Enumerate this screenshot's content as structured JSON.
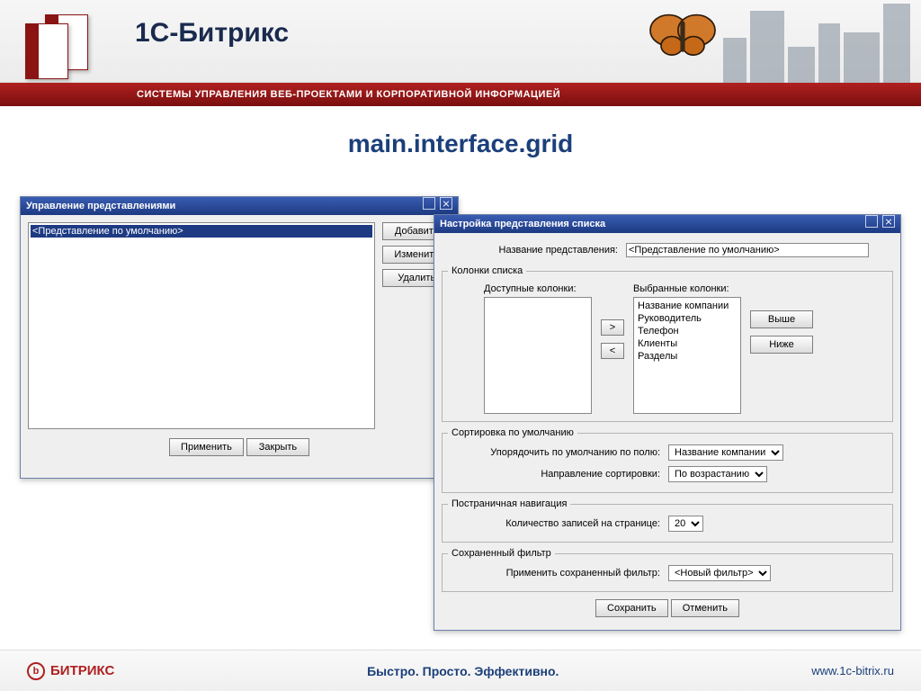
{
  "header": {
    "brand": "1С-Битрикс",
    "tagline": "СИСТЕМЫ УПРАВЛЕНИЯ ВЕБ-ПРОЕКТАМИ И КОРПОРАТИВНОЙ ИНФОРМАЦИЕЙ"
  },
  "page_title": "main.interface.grid",
  "dialog1": {
    "title": "Управление представлениями",
    "selected_item": "<Представление по умолчанию>",
    "buttons": {
      "add": "Добавить",
      "edit": "Изменить",
      "delete": "Удалить"
    },
    "footer": {
      "apply": "Применить",
      "close": "Закрыть"
    }
  },
  "dialog2": {
    "title": "Настройка представления списка",
    "name_label": "Название представления:",
    "name_value": "<Представление по умолчанию>",
    "columns_group": "Колонки списка",
    "available_label": "Доступные колонки:",
    "selected_label": "Выбранные колонки:",
    "selected_items": [
      "Название компании",
      "Руководитель",
      "Телефон",
      "Клиенты",
      "Разделы"
    ],
    "move_right": ">",
    "move_left": "<",
    "up": "Выше",
    "down": "Ниже",
    "sort_group": "Сортировка по умолчанию",
    "sort_field_label": "Упорядочить по умолчанию по полю:",
    "sort_field_value": "Название компании",
    "sort_dir_label": "Направление сортировки:",
    "sort_dir_value": "По возрастанию",
    "pager_group": "Постраничная навигация",
    "pager_label": "Количество записей на странице:",
    "pager_value": "20",
    "filter_group": "Сохраненный фильтр",
    "filter_label": "Применить сохраненный фильтр:",
    "filter_value": "<Новый фильтр>",
    "footer": {
      "save": "Сохранить",
      "cancel": "Отменить"
    }
  },
  "footer": {
    "brand": "БИТРИКС",
    "slogan": "Быстро. Просто. Эффективно.",
    "url": "www.1c-bitrix.ru"
  }
}
